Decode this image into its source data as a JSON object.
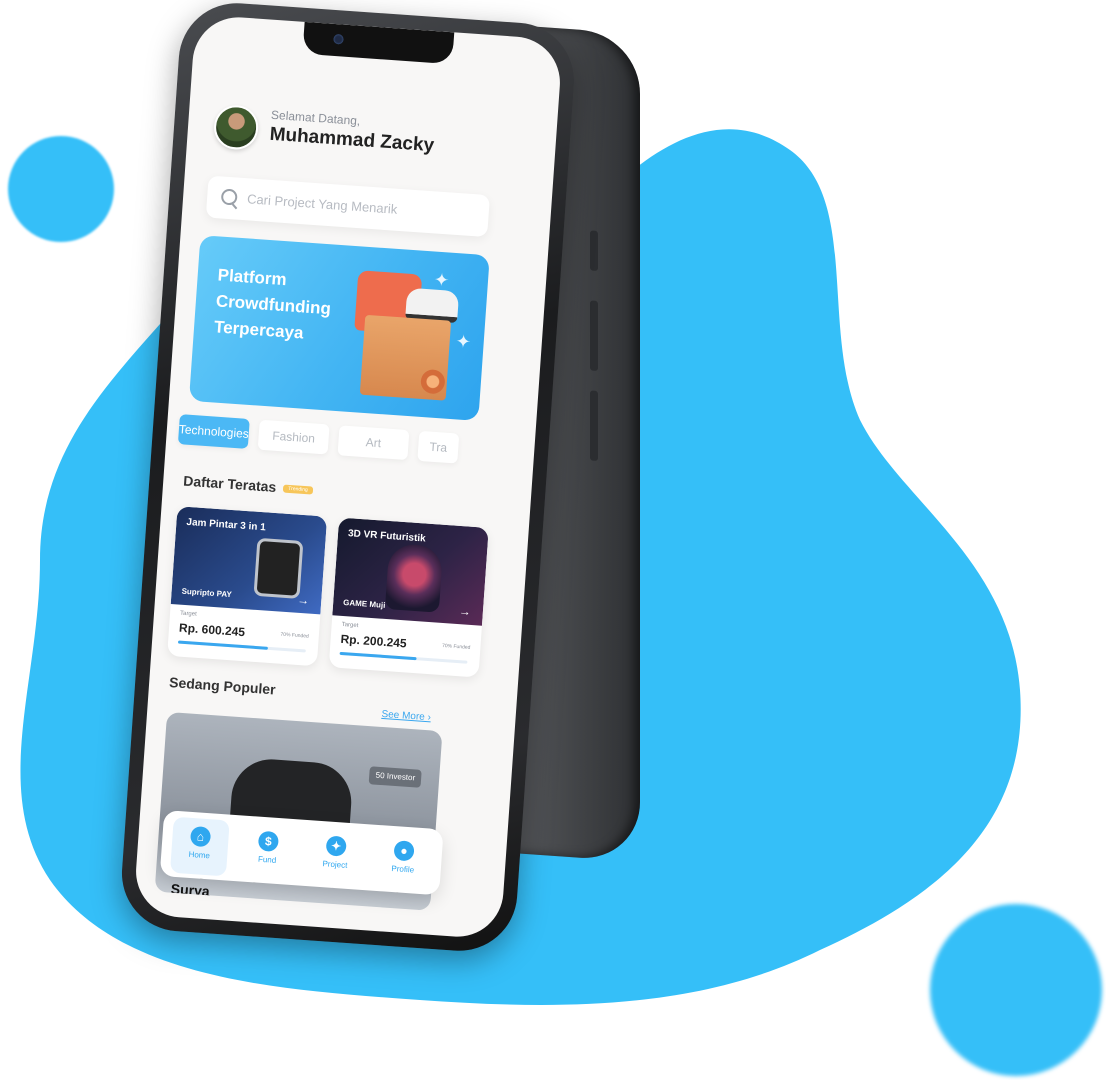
{
  "colors": {
    "accent": "#35bff8",
    "primary": "#2fa7ef",
    "screen_bg": "#f8f7f6"
  },
  "header": {
    "greeting": "Selamat Datang,",
    "user_name": "Muhammad Zacky"
  },
  "search": {
    "placeholder": "Cari Project Yang Menarik",
    "icon": "search-icon"
  },
  "banner": {
    "lines": [
      "Platform",
      "Crowdfunding",
      "Terpercaya"
    ]
  },
  "categories": [
    {
      "label": "Technologies",
      "active": true
    },
    {
      "label": "Fashion",
      "active": false
    },
    {
      "label": "Art",
      "active": false
    },
    {
      "label": "Tra",
      "active": false
    }
  ],
  "top_section": {
    "title": "Daftar Teratas",
    "tag": "Trending"
  },
  "top_cards": [
    {
      "title": "Jam Pintar 3 in 1",
      "brand": "Supripto PAY",
      "target_label": "Target",
      "amount": "Rp. 600.245",
      "funded_label": "70% Funded",
      "progress": 0.7
    },
    {
      "title": "3D VR Futuristik",
      "brand": "GAME Muji",
      "target_label": "Target",
      "amount": "Rp. 200.245",
      "funded_label": "70% Funded",
      "progress": 0.6
    }
  ],
  "popular_section": {
    "title": "Sedang Populer",
    "see_more": "See More ›"
  },
  "popular_card": {
    "investor_badge": "50 Investor",
    "title": "Pengembangan Motor Sport Tenaga Surya"
  },
  "nav": [
    {
      "label": "Home",
      "icon": "home-icon",
      "glyph": "⌂",
      "active": true
    },
    {
      "label": "Fund",
      "icon": "dollar-icon",
      "glyph": "$",
      "active": false
    },
    {
      "label": "Project",
      "icon": "lightbulb-icon",
      "glyph": "✦",
      "active": false
    },
    {
      "label": "Profile",
      "icon": "user-icon",
      "glyph": "●",
      "active": false
    }
  ]
}
